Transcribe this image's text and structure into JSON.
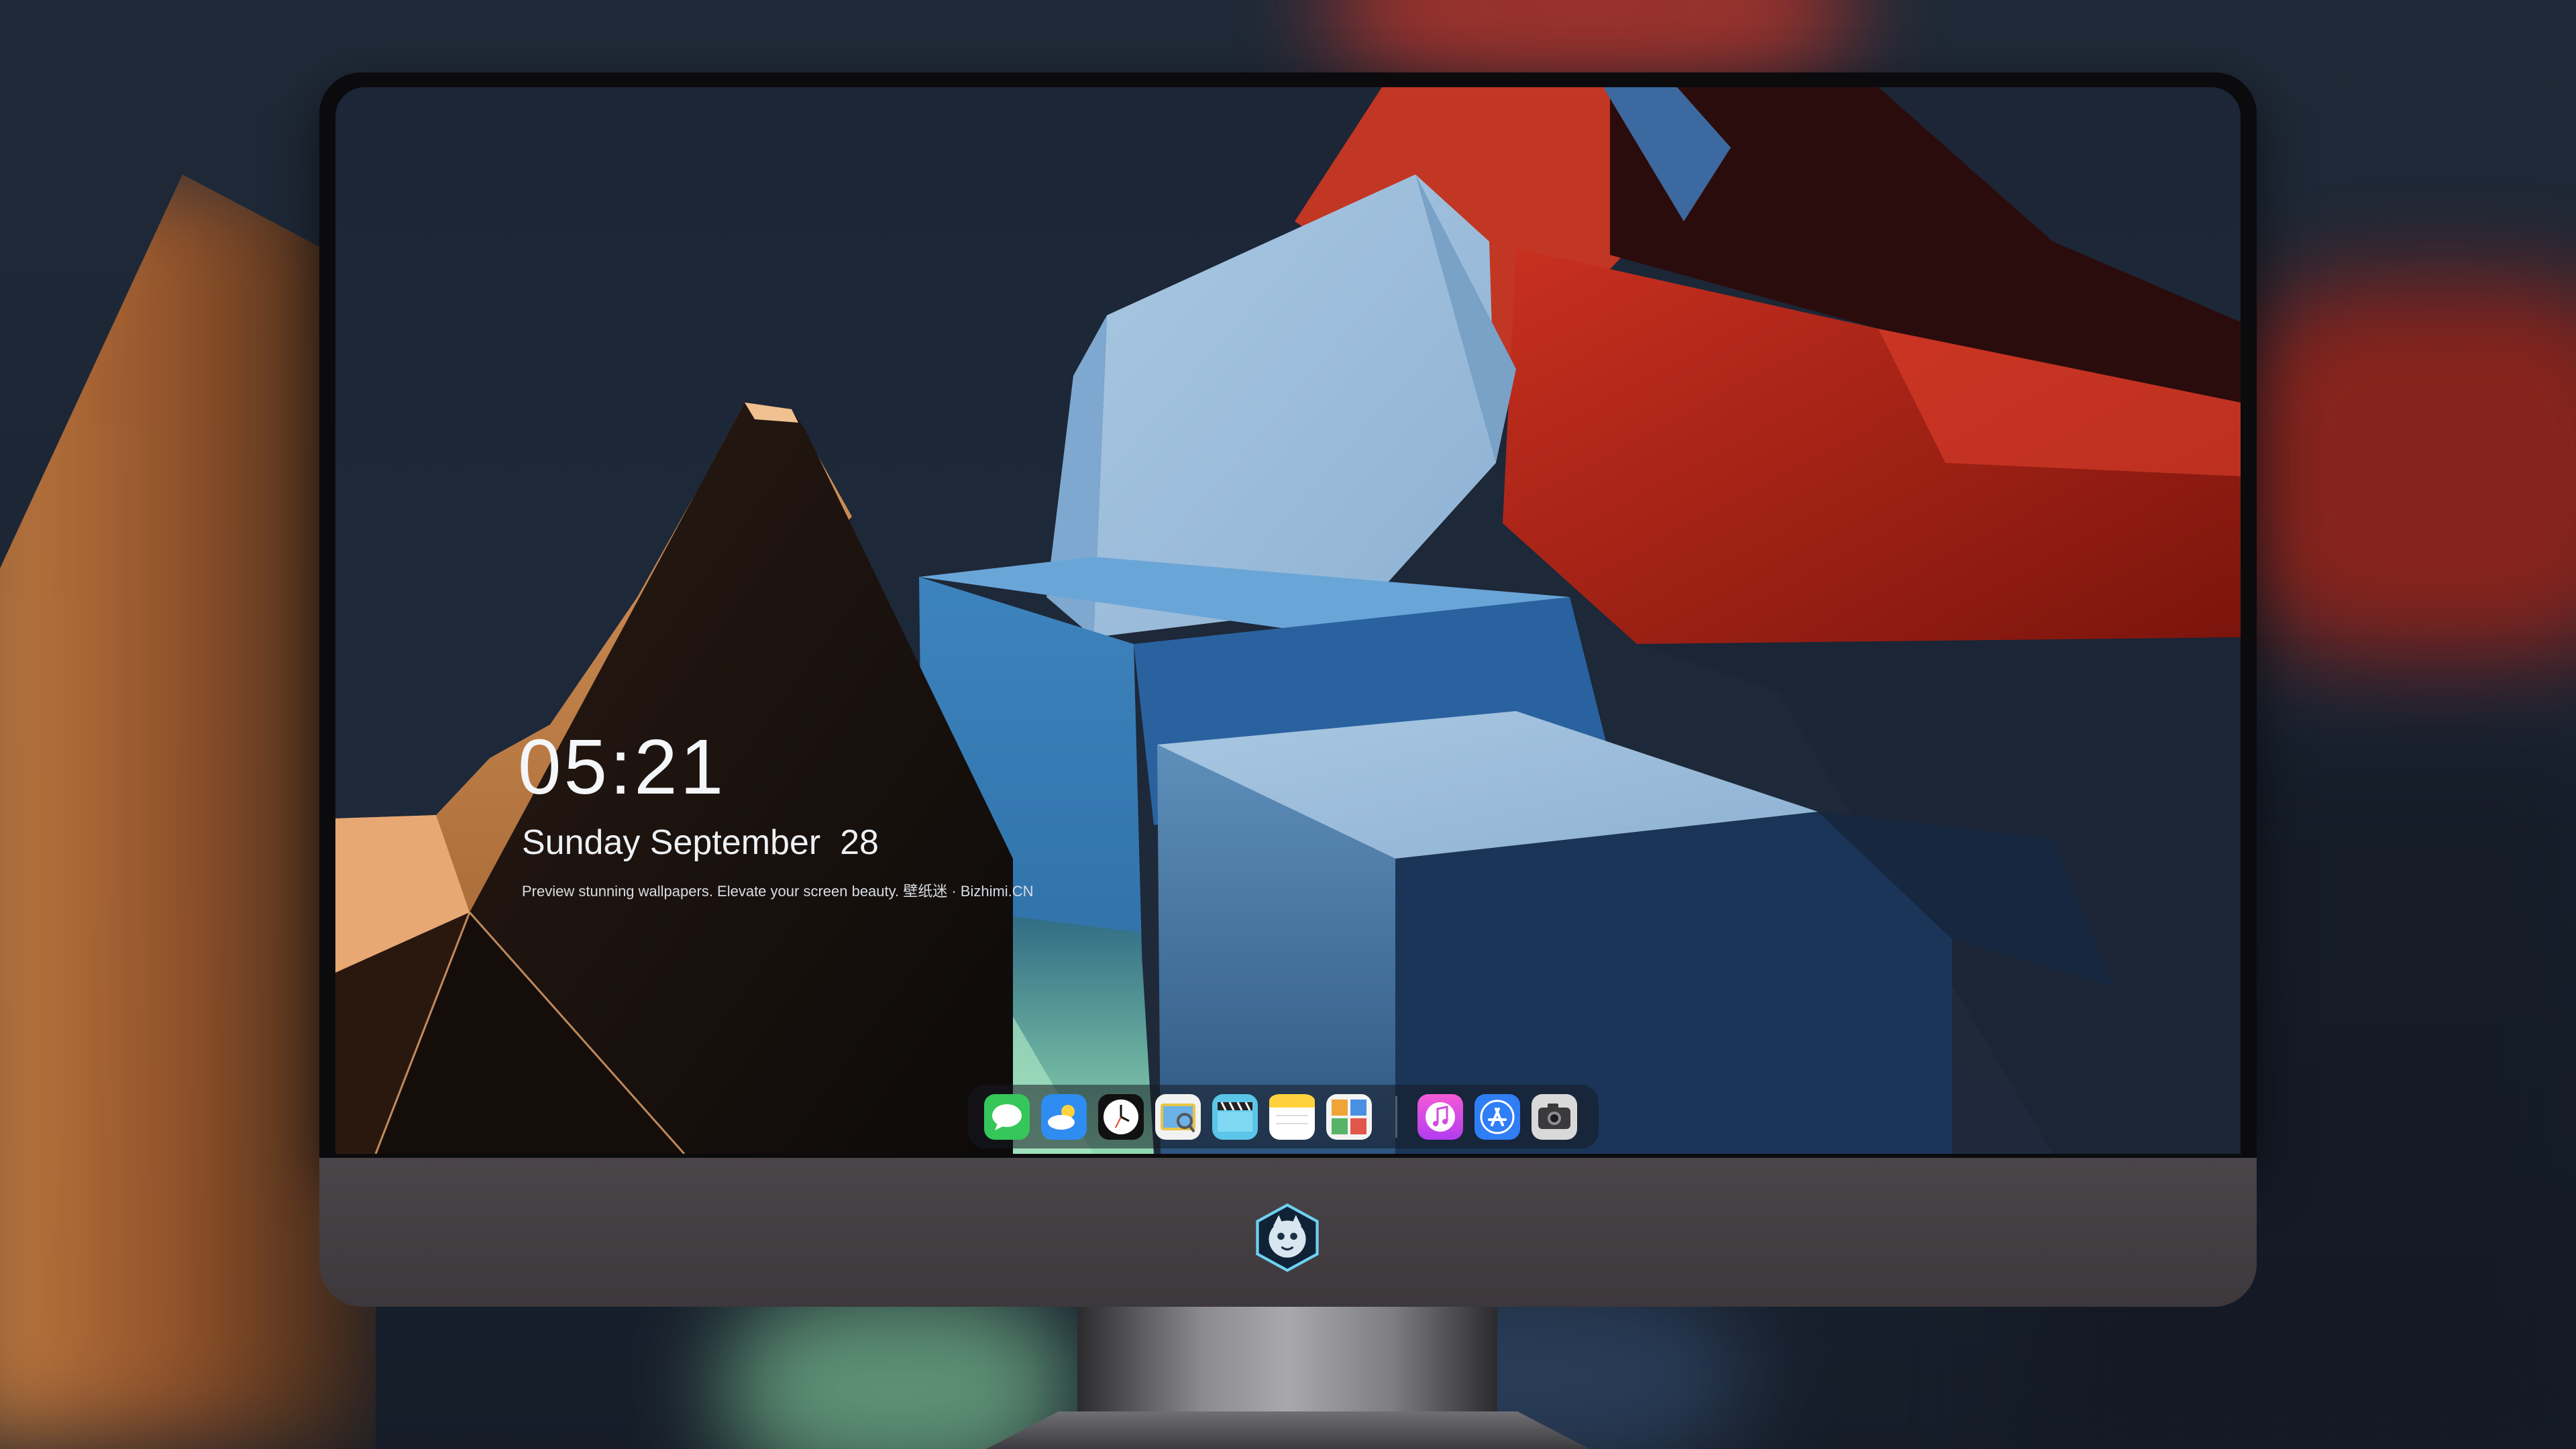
{
  "lock_screen": {
    "time": "05:21",
    "date": "Sunday September  28",
    "caption": "Preview stunning wallpapers. Elevate your screen beauty. 壁纸迷 · Bizhimi.CN"
  },
  "dock": {
    "apps": [
      {
        "icon": "messages-icon"
      },
      {
        "icon": "weather-icon"
      },
      {
        "icon": "clock-icon"
      },
      {
        "icon": "preview-icon"
      },
      {
        "icon": "clips-icon"
      },
      {
        "icon": "notes-icon"
      },
      {
        "icon": "photo-booth-icon"
      },
      {
        "icon": "music-icon"
      },
      {
        "icon": "app-store-icon"
      },
      {
        "icon": "camera-icon"
      }
    ]
  },
  "colors": {
    "screen_background": "#1d2738",
    "orange_shape": "#c9834a",
    "red_shape": "#b0261c",
    "blue_shape": "#5f95c6"
  }
}
